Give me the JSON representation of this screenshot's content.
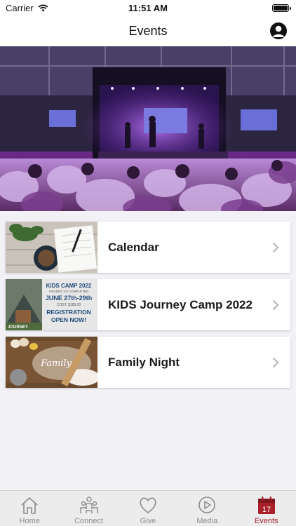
{
  "status_bar": {
    "carrier": "Carrier",
    "time": "11:51 AM"
  },
  "nav": {
    "title": "Events"
  },
  "events": [
    {
      "label": "Calendar"
    },
    {
      "label": "KIDS Journey Camp 2022"
    },
    {
      "label": "Family Night"
    }
  ],
  "kids_thumb": {
    "line1": "KIDS CAMP 2022",
    "line2": "GRADES 1-5 COMPLETED",
    "line3": "JUNE 27th-29th",
    "line4": "COST: $185.00",
    "line5": "REGISTRATION",
    "line6": "OPEN NOW!",
    "brand": "JOURNEY"
  },
  "family_thumb": {
    "script": "Family"
  },
  "tabs": [
    {
      "label": "Home",
      "icon": "home-icon"
    },
    {
      "label": "Connect",
      "icon": "connect-icon"
    },
    {
      "label": "Give",
      "icon": "heart-icon"
    },
    {
      "label": "Media",
      "icon": "play-icon"
    },
    {
      "label": "Events",
      "icon": "calendar-icon",
      "badge": "17"
    }
  ],
  "colors": {
    "accent": "#a8202a",
    "tab_inactive": "#8b8b8b",
    "background": "#f2f2f6"
  }
}
